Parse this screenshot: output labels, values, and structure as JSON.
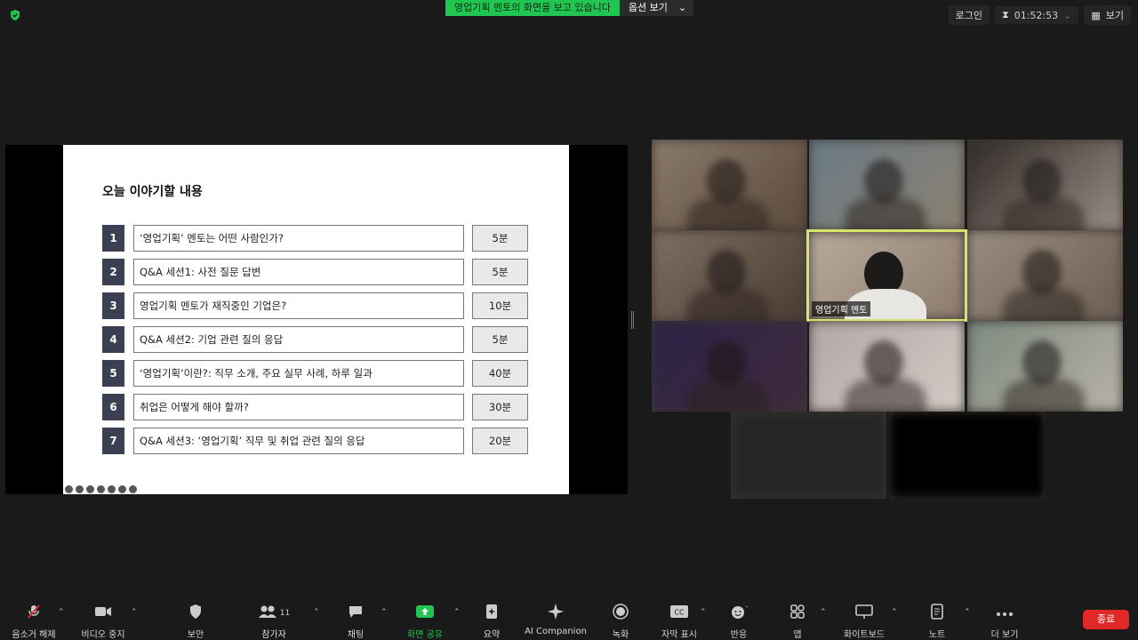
{
  "topbar": {
    "sharing_text": "영업기획 멘토의 화면을 보고 있습니다",
    "view_options": "옵션 보기",
    "login": "로그인",
    "timer": "01:52:53",
    "view": "보기"
  },
  "slide": {
    "title": "오늘 이야기할 내용",
    "rows": [
      {
        "num": "1",
        "text": "‘영업기획’ 멘토는 어떤 사람인가?",
        "duration": "5분"
      },
      {
        "num": "2",
        "text": "Q&A 세션1: 사전 질문 답변",
        "duration": "5분"
      },
      {
        "num": "3",
        "text": "영업기획 멘토가 재직중인 기업은?",
        "duration": "10분"
      },
      {
        "num": "4",
        "text": "Q&A 세션2: 기업 관련 질의 응답",
        "duration": "5분"
      },
      {
        "num": "5",
        "text": "‘영업기획’이란?: 직무 소개, 주요 실무 사례, 하루 일과",
        "duration": "40분"
      },
      {
        "num": "6",
        "text": "취업은 어떻게 해야 할까?",
        "duration": "30분"
      },
      {
        "num": "7",
        "text": "Q&A 세션3: ‘영업기획’ 직무 및 취업 관련 질의 응답",
        "duration": "20분"
      }
    ]
  },
  "gallery": {
    "active_name": "영업기획 멘토"
  },
  "toolbar": {
    "items": [
      {
        "label": "음소거 해제",
        "icon": "mic-muted-icon"
      },
      {
        "label": "비디오 중지",
        "icon": "video-icon"
      },
      {
        "label": "보안",
        "icon": "shield-icon"
      },
      {
        "label": "참가자",
        "icon": "participants-icon",
        "count": "11"
      },
      {
        "label": "채팅",
        "icon": "chat-icon"
      },
      {
        "label": "화면 공유",
        "icon": "share-screen-icon"
      },
      {
        "label": "요약",
        "icon": "summary-icon"
      },
      {
        "label": "AI Companion",
        "icon": "ai-sparkle-icon"
      },
      {
        "label": "녹화",
        "icon": "record-icon"
      },
      {
        "label": "자막 표시",
        "icon": "cc-icon"
      },
      {
        "label": "반응",
        "icon": "reaction-icon"
      },
      {
        "label": "앱",
        "icon": "apps-icon"
      },
      {
        "label": "화이트보드",
        "icon": "whiteboard-icon"
      },
      {
        "label": "노트",
        "icon": "notes-icon"
      },
      {
        "label": "더 보기",
        "icon": "more-icon"
      }
    ],
    "end": "종료"
  },
  "colors": {
    "share_green": "#23c552",
    "active_border": "#d6e46a",
    "end_red": "#e02828",
    "slide_num_bg": "#3a3f52"
  }
}
